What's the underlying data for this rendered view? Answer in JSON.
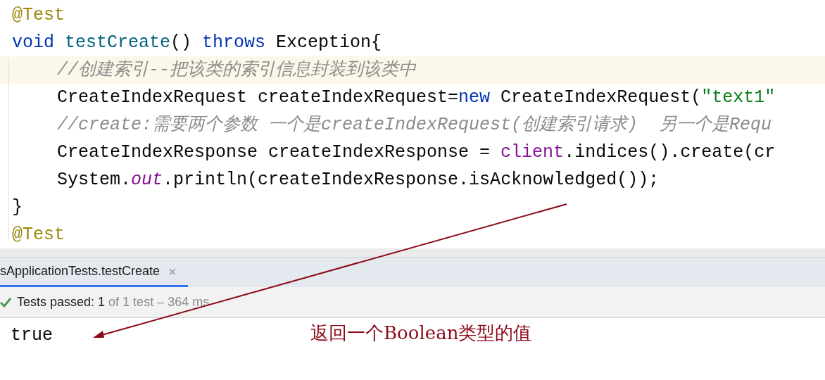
{
  "editor": {
    "lines": [
      {
        "highlighted": false,
        "tokens": [
          {
            "kind": "annotation",
            "text": "@Test"
          }
        ]
      },
      {
        "highlighted": false,
        "tokens": [
          {
            "kind": "keyword",
            "text": "void "
          },
          {
            "kind": "method",
            "text": "testCreate"
          },
          {
            "kind": "plain",
            "text": "() "
          },
          {
            "kind": "keyword",
            "text": "throws "
          },
          {
            "kind": "plain",
            "text": "Exception{"
          }
        ],
        "body": [
          {
            "highlighted": true,
            "tokens": [
              {
                "kind": "comment",
                "text": "//创建索引--把该类的索引信息封装到该类中"
              }
            ]
          },
          {
            "highlighted": false,
            "tokens": [
              {
                "kind": "plain",
                "text": "CreateIndexRequest createIndexRequest="
              },
              {
                "kind": "keyword",
                "text": "new "
              },
              {
                "kind": "plain",
                "text": "CreateIndexRequest("
              },
              {
                "kind": "string",
                "text": "\"text1\""
              }
            ]
          },
          {
            "highlighted": false,
            "tokens": [
              {
                "kind": "comment",
                "text": "//create:需要两个参数 一个是createIndexRequest(创建索引请求)  另一个是Requ"
              }
            ]
          },
          {
            "highlighted": false,
            "tokens": [
              {
                "kind": "plain",
                "text": "CreateIndexResponse createIndexResponse = "
              },
              {
                "kind": "field",
                "text": "client"
              },
              {
                "kind": "plain",
                "text": ".indices().create(cr"
              }
            ]
          },
          {
            "highlighted": false,
            "tokens": [
              {
                "kind": "plain",
                "text": "System."
              },
              {
                "kind": "static_field",
                "text": "out"
              },
              {
                "kind": "plain",
                "text": ".println(createIndexResponse.isAcknowledged());"
              }
            ]
          }
        ]
      },
      {
        "highlighted": false,
        "tokens": [
          {
            "kind": "plain",
            "text": "}"
          }
        ]
      },
      {
        "highlighted": false,
        "tokens": [
          {
            "kind": "annotation",
            "text": "@Test"
          }
        ]
      }
    ]
  },
  "run_panel": {
    "tab": {
      "label": "sApplicationTests.testCreate",
      "selected": true,
      "close": "×"
    },
    "status": {
      "passed": "Tests passed: 1",
      "detail": "of 1 test – 364 ms"
    },
    "output": "true"
  },
  "annotation": {
    "text": "返回一个Boolean类型的值"
  }
}
